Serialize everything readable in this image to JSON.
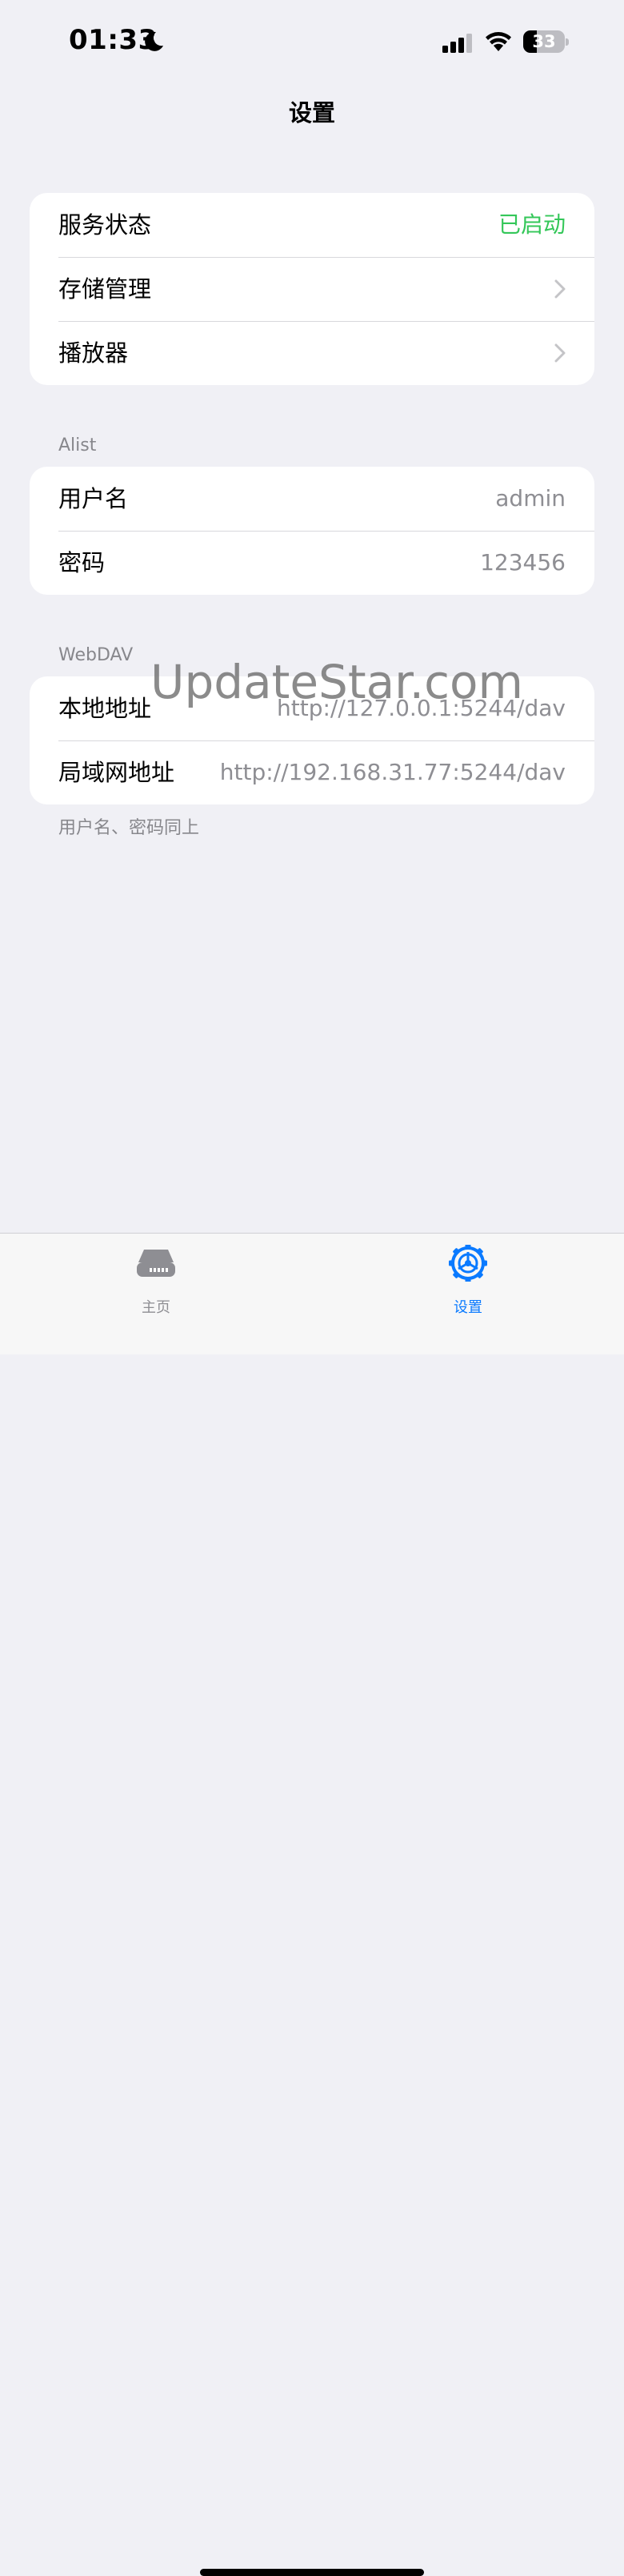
{
  "status_bar": {
    "time": "01:33",
    "battery": "33",
    "battery_level": 0.33
  },
  "nav": {
    "title": "设置"
  },
  "general": {
    "rows": [
      {
        "label": "服务状态",
        "value": "已启动"
      },
      {
        "label": "存储管理"
      },
      {
        "label": "播放器"
      }
    ]
  },
  "alist": {
    "header": "Alist",
    "rows": [
      {
        "label": "用户名",
        "value": "admin"
      },
      {
        "label": "密码",
        "value": "123456"
      }
    ]
  },
  "webdav": {
    "header": "WebDAV",
    "rows": [
      {
        "label": "本地地址",
        "value": "http://127.0.0.1:5244/dav"
      },
      {
        "label": "局域网地址",
        "value": "http://192.168.31.77:5244/dav"
      }
    ],
    "footer": "用户名、密码同上"
  },
  "watermark": "UpdateStar.com",
  "tabs": [
    {
      "label": "主页",
      "icon": "server-drive-icon",
      "active": false
    },
    {
      "label": "设置",
      "icon": "gear-icon",
      "active": true
    }
  ],
  "colors": {
    "accent": "#0a7aff",
    "status_on": "#34c759",
    "background": "#f0f0f5",
    "tab_inactive": "#8e8e93"
  }
}
